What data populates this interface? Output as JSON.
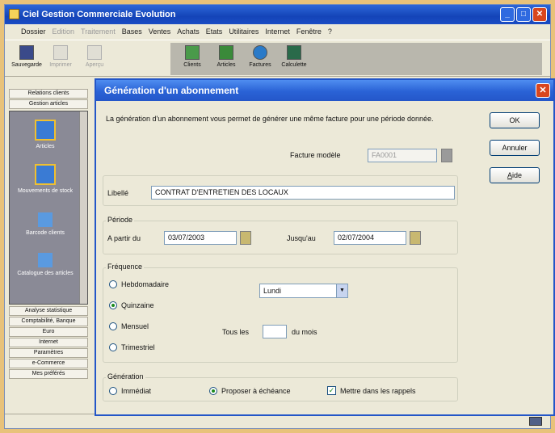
{
  "app": {
    "title": "Ciel Gestion Commerciale Evolution",
    "menu": [
      {
        "label": "Dossier",
        "enabled": true
      },
      {
        "label": "Edition",
        "enabled": false
      },
      {
        "label": "Traitement",
        "enabled": false
      },
      {
        "label": "Bases",
        "enabled": true
      },
      {
        "label": "Ventes",
        "enabled": true
      },
      {
        "label": "Achats",
        "enabled": true
      },
      {
        "label": "Etats",
        "enabled": true
      },
      {
        "label": "Utilitaires",
        "enabled": true
      },
      {
        "label": "Internet",
        "enabled": true
      },
      {
        "label": "Fenêtre",
        "enabled": true
      },
      {
        "label": "?",
        "enabled": true
      }
    ],
    "toolbar_left": [
      {
        "label": "Sauvegarde",
        "enabled": true
      },
      {
        "label": "Imprimer",
        "enabled": false
      },
      {
        "label": "Aperçu",
        "enabled": false
      }
    ],
    "toolbar_right": [
      {
        "label": "Clients"
      },
      {
        "label": "Articles"
      },
      {
        "label": "Factures"
      },
      {
        "label": "Calculette"
      }
    ]
  },
  "sidebar": {
    "top_buttons": [
      "Relations clients",
      "Gestion articles"
    ],
    "items": [
      "Articles",
      "Mouvements de stock",
      "Barcode clients",
      "Catalogue des articles"
    ],
    "bottom_buttons": [
      "Analyse statistique",
      "Comptabilité, Banque",
      "Euro",
      "Internet",
      "Paramètres",
      "e-Commerce",
      "Mes préférés"
    ]
  },
  "dialog": {
    "title": "Génération d'un abonnement",
    "description": "La génération d'un abonnement vous permet de générer une même facture pour une période donnée.",
    "buttons": {
      "ok": "OK",
      "cancel": "Annuler",
      "help_underlined": "A",
      "help_rest": "ide"
    },
    "model": {
      "label": "Facture modèle",
      "value": "FA0001"
    },
    "libelle": {
      "label": "Libellé",
      "value": "CONTRAT D'ENTRETIEN DES LOCAUX"
    },
    "periode": {
      "title": "Période",
      "from_label": "A partir du",
      "from_value": "03/07/2003",
      "to_label": "Jusqu'au",
      "to_value": "02/07/2004"
    },
    "frequence": {
      "title": "Fréquence",
      "options": [
        "Hebdomadaire",
        "Quinzaine",
        "Mensuel",
        "Trimestriel"
      ],
      "selected": "Quinzaine",
      "day_value": "Lundi",
      "tous_les_label": "Tous les",
      "tous_les_value": "",
      "du_mois_label": "du mois"
    },
    "generation": {
      "title": "Génération",
      "options": [
        "Immédiat",
        "Proposer à échéance"
      ],
      "selected": "Proposer à échéance",
      "reminder_label": "Mettre dans les rappels",
      "reminder_checked": true
    }
  },
  "colors": {
    "titlebar": "#1444b8",
    "dialog_titlebar": "#2a62d6",
    "close_button": "#d8461e",
    "background": "#ece9d8"
  }
}
